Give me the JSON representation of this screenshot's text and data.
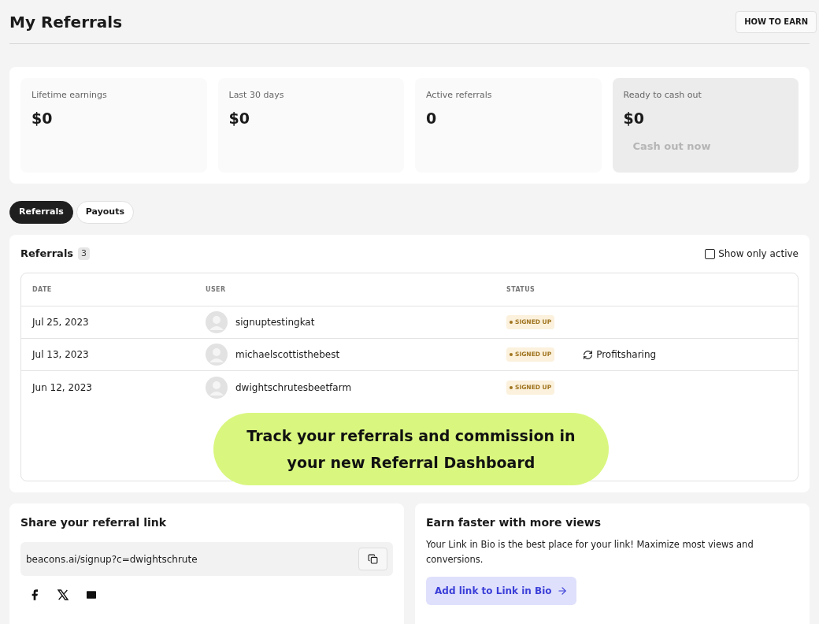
{
  "header": {
    "title": "My Referrals",
    "button": "HOW TO EARN"
  },
  "stats": [
    {
      "label": "Lifetime earnings",
      "value": "$0",
      "kind": "plain"
    },
    {
      "label": "Last 30 days",
      "value": "$0",
      "kind": "plain"
    },
    {
      "label": "Active referrals",
      "value": "0",
      "kind": "plain"
    },
    {
      "label": "Ready to cash out",
      "value": "$0",
      "kind": "cashout",
      "action": "Cash out now",
      "disabled": true
    }
  ],
  "tabs": [
    {
      "label": "Referrals",
      "selected": true
    },
    {
      "label": "Payouts",
      "selected": false
    }
  ],
  "referrals": {
    "title": "Referrals",
    "count": "3",
    "filter": {
      "label": "Show only active",
      "checked": false
    },
    "columns": [
      "DATE",
      "USER",
      "STATUS"
    ],
    "rows": [
      {
        "date": "Jul 25, 2023",
        "user": "signuptestingkat",
        "status": "SIGNED UP"
      },
      {
        "date": "Jul 13, 2023",
        "user": "michaelscottisthebest",
        "status": "SIGNED UP",
        "program": "Profitsharing"
      },
      {
        "date": "Jun 12, 2023",
        "user": "dwightschrutesbeetfarm",
        "status": "SIGNED UP"
      }
    ],
    "banner": [
      "Track your referrals and commission in",
      "your new Referral Dashboard"
    ]
  },
  "share": {
    "title": "Share your referral link",
    "link": "beacons.ai/signup?c=dwightschrute"
  },
  "promo": {
    "title": "Earn faster with more views",
    "text": "Your Link in Bio is the best place for your link! Maximize most views and conversions.",
    "button": "Add link to Link in Bio"
  }
}
